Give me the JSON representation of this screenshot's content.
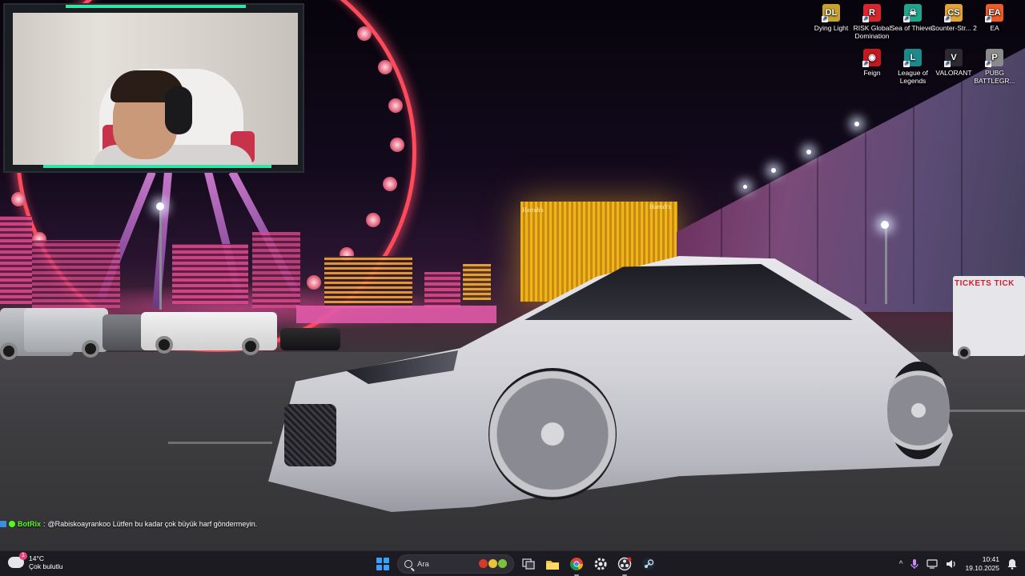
{
  "desktop": {
    "icons_row1": [
      {
        "label": "Dying Light",
        "icon": "dying-light-icon",
        "color": "#c9a22a",
        "glyph": "DL"
      },
      {
        "label": "RISK Global Domination",
        "icon": "risk-icon",
        "color": "#d8262e",
        "glyph": "R"
      },
      {
        "label": "Sea of Thieves",
        "icon": "sea-of-thieves-icon",
        "color": "#1fa58a",
        "glyph": "☠"
      },
      {
        "label": "Counter-Str... 2",
        "icon": "counter-strike-icon",
        "color": "#e3a336",
        "glyph": "CS"
      },
      {
        "label": "EA",
        "icon": "ea-icon",
        "color": "#f05a24",
        "glyph": "EA"
      }
    ],
    "icons_row2": [
      {
        "label": "Feign",
        "icon": "feign-icon",
        "color": "#c2191e",
        "glyph": "◉"
      },
      {
        "label": "League of Legends",
        "icon": "league-of-legends-icon",
        "color": "#1b8a8a",
        "glyph": "L"
      },
      {
        "label": "VALORANT",
        "icon": "valorant-icon",
        "color": "#2a2a30",
        "glyph": "V"
      },
      {
        "label": "PUBG BATTLEGR...",
        "icon": "pubg-icon",
        "color": "#8a8a8a",
        "glyph": "P"
      }
    ]
  },
  "chat": {
    "username": "BotRix",
    "separator": ":",
    "message": "@Rabiskoayrankoo Lütfen bu kadar çok büyük harf göndermeyin."
  },
  "wallpaper": {
    "hotel_sign": "Harrah's",
    "trailer_text": "TICKETS TICK"
  },
  "taskbar": {
    "weather": {
      "temperature": "14°C",
      "condition": "Çok bulutlu",
      "alert_count": "1"
    },
    "search": {
      "placeholder": "Ara"
    },
    "apps": [
      {
        "name": "task-view-icon",
        "active": false
      },
      {
        "name": "file-explorer-icon",
        "active": false
      },
      {
        "name": "chrome-icon",
        "active": true
      },
      {
        "name": "settings-app-icon",
        "active": false
      },
      {
        "name": "obs-icon",
        "active": true
      },
      {
        "name": "steam-icon",
        "active": false
      }
    ],
    "tray": {
      "chevron": "^",
      "time": "10:41",
      "date": "19.10.2025"
    }
  },
  "colors": {
    "accent": "#2ee6a6",
    "taskbar_bg": "#1c1b22",
    "chat_username": "#53fc18"
  }
}
